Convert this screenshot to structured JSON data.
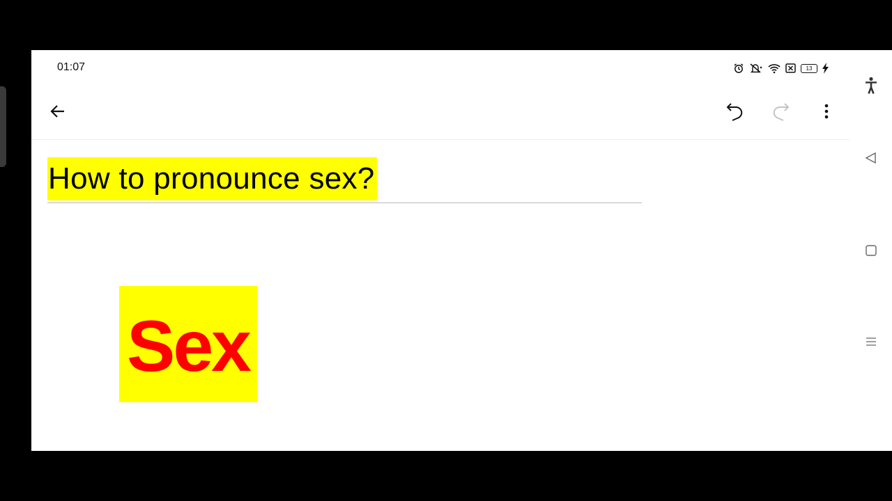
{
  "status_bar": {
    "time": "01:07",
    "battery_level": "13",
    "icons": [
      "alarm-icon",
      "silent-icon",
      "wifi-icon",
      "close-box-icon",
      "battery-icon",
      "charging-icon"
    ]
  },
  "toolbar": {
    "back_icon": "arrow-left-icon",
    "undo_icon": "undo-icon",
    "redo_icon": "redo-icon",
    "redo_enabled": false,
    "more_icon": "more-vertical-icon"
  },
  "note": {
    "heading": "How to pronounce sex?",
    "word": "Sex",
    "highlight_color": "#ffff00",
    "word_color": "#ff0000"
  },
  "nav_rail": {
    "icons": [
      "accessibility-icon",
      "back-triangle-icon",
      "home-square-icon",
      "recents-lines-icon"
    ]
  }
}
